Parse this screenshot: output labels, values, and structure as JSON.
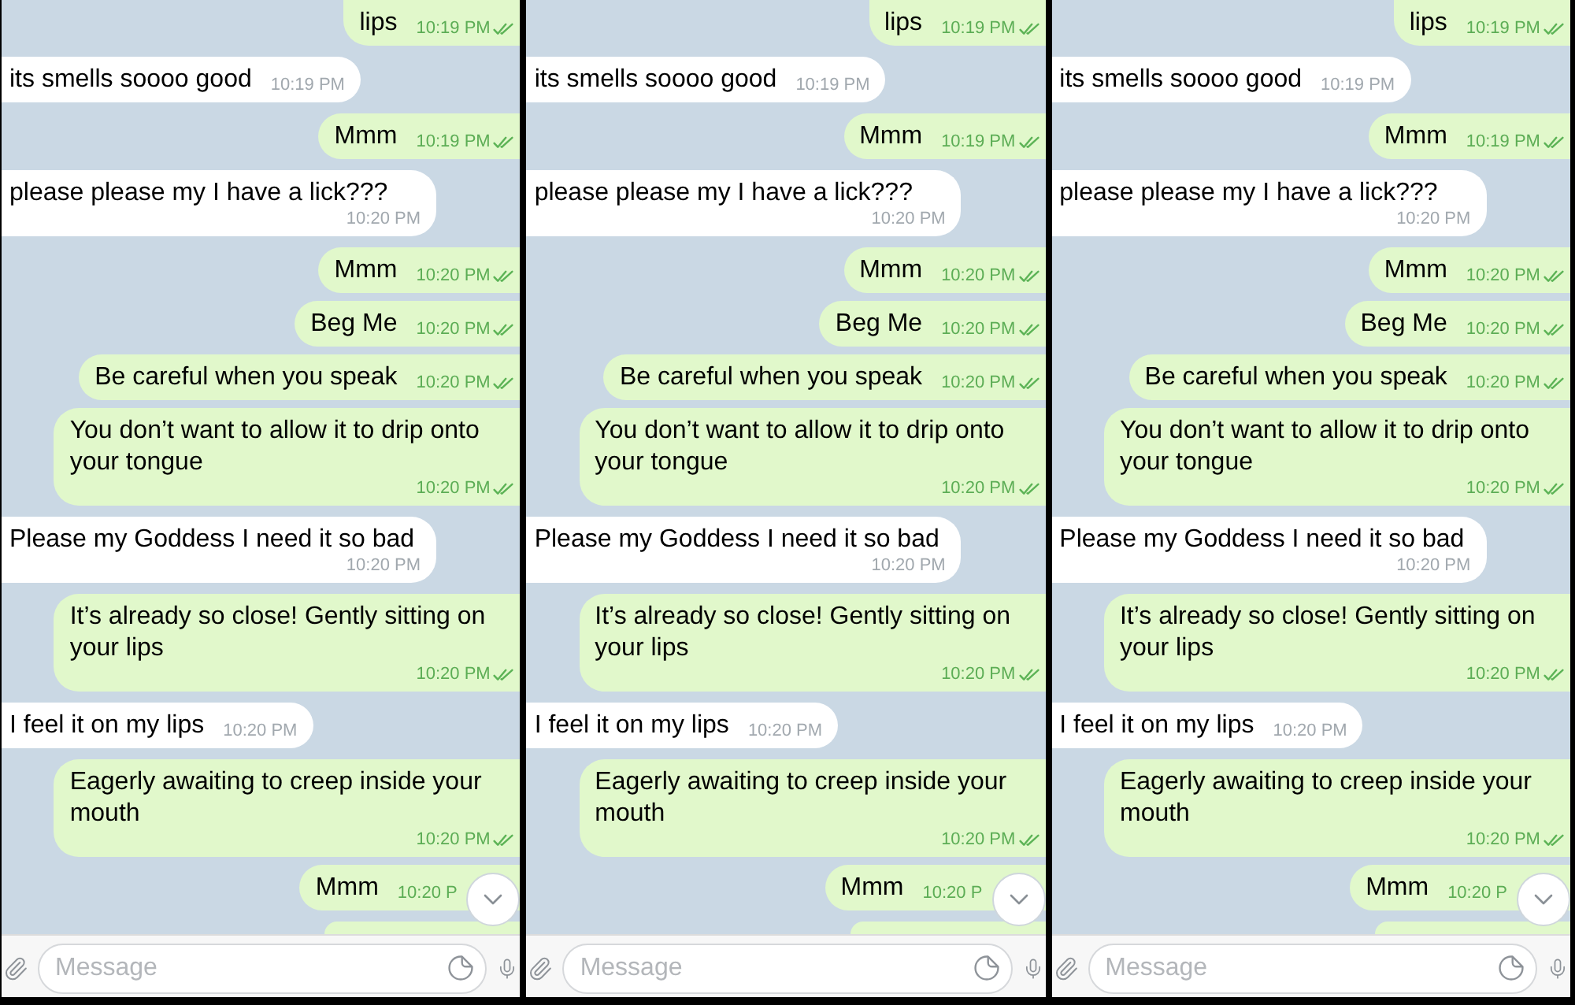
{
  "panels": [
    {
      "messages": [
        {
          "kind": "outgoing",
          "text": "lips",
          "time": "10:19 PM",
          "read": true
        },
        {
          "kind": "incoming",
          "text": "its smells soooo good",
          "time": "10:19 PM"
        },
        {
          "kind": "outgoing",
          "text": "Mmm",
          "time": "10:19 PM",
          "read": true
        },
        {
          "kind": "incoming",
          "text": "please please my I have a lick???",
          "time": "10:20 PM"
        },
        {
          "kind": "outgoing",
          "text": "Mmm",
          "time": "10:20 PM",
          "read": true
        },
        {
          "kind": "outgoing",
          "text": "Beg Me",
          "time": "10:20 PM",
          "read": true
        },
        {
          "kind": "outgoing",
          "text": "Be careful when you speak",
          "time": "10:20 PM",
          "read": true
        },
        {
          "kind": "outgoing",
          "text": "You don’t want to allow it to drip onto your tongue",
          "time": "10:20 PM",
          "read": true
        },
        {
          "kind": "incoming",
          "text": "Please my Goddess I need it so bad",
          "time": "10:20 PM"
        },
        {
          "kind": "outgoing",
          "text": "It’s already so close! Gently sitting on your lips",
          "time": "10:20 PM",
          "read": true
        },
        {
          "kind": "incoming",
          "text": "I feel it on my lips",
          "time": "10:20 PM"
        },
        {
          "kind": "outgoing",
          "text": "Eagerly awaiting to creep inside your mouth",
          "time": "10:20 PM",
          "read": true
        },
        {
          "kind": "outgoing",
          "text": "Mmm",
          "time": "10:20 P"
        },
        {
          "kind": "partial"
        }
      ],
      "composer": {
        "placeholder": "Message"
      }
    },
    {
      "messages": [
        {
          "kind": "outgoing",
          "text": "lips",
          "time": "10:19 PM",
          "read": true
        },
        {
          "kind": "incoming",
          "text": "its smells soooo good",
          "time": "10:19 PM"
        },
        {
          "kind": "outgoing",
          "text": "Mmm",
          "time": "10:19 PM",
          "read": true
        },
        {
          "kind": "incoming",
          "text": "please please my I have a lick???",
          "time": "10:20 PM"
        },
        {
          "kind": "outgoing",
          "text": "Mmm",
          "time": "10:20 PM",
          "read": true
        },
        {
          "kind": "outgoing",
          "text": "Beg Me",
          "time": "10:20 PM",
          "read": true
        },
        {
          "kind": "outgoing",
          "text": "Be careful when you speak",
          "time": "10:20 PM",
          "read": true
        },
        {
          "kind": "outgoing",
          "text": "You don’t want to allow it to drip onto your tongue",
          "time": "10:20 PM",
          "read": true
        },
        {
          "kind": "incoming",
          "text": "Please my Goddess I need it so bad",
          "time": "10:20 PM"
        },
        {
          "kind": "outgoing",
          "text": "It’s already so close! Gently sitting on your lips",
          "time": "10:20 PM",
          "read": true
        },
        {
          "kind": "incoming",
          "text": "I feel it on my lips",
          "time": "10:20 PM"
        },
        {
          "kind": "outgoing",
          "text": "Eagerly awaiting to creep inside your mouth",
          "time": "10:20 PM",
          "read": true
        },
        {
          "kind": "outgoing",
          "text": "Mmm",
          "time": "10:20 P"
        },
        {
          "kind": "partial"
        }
      ],
      "composer": {
        "placeholder": "Message"
      }
    },
    {
      "messages": [
        {
          "kind": "outgoing",
          "text": "lips",
          "time": "10:19 PM",
          "read": true
        },
        {
          "kind": "incoming",
          "text": "its smells soooo good",
          "time": "10:19 PM"
        },
        {
          "kind": "outgoing",
          "text": "Mmm",
          "time": "10:19 PM",
          "read": true
        },
        {
          "kind": "incoming",
          "text": "please please my I have a lick???",
          "time": "10:20 PM"
        },
        {
          "kind": "outgoing",
          "text": "Mmm",
          "time": "10:20 PM",
          "read": true
        },
        {
          "kind": "outgoing",
          "text": "Beg Me",
          "time": "10:20 PM",
          "read": true
        },
        {
          "kind": "outgoing",
          "text": "Be careful when you speak",
          "time": "10:20 PM",
          "read": true
        },
        {
          "kind": "outgoing",
          "text": "You don’t want to allow it to drip onto your tongue",
          "time": "10:20 PM",
          "read": true
        },
        {
          "kind": "incoming",
          "text": "Please my Goddess I need it so bad",
          "time": "10:20 PM"
        },
        {
          "kind": "outgoing",
          "text": "It’s already so close! Gently sitting on your lips",
          "time": "10:20 PM",
          "read": true
        },
        {
          "kind": "incoming",
          "text": "I feel it on my lips",
          "time": "10:20 PM"
        },
        {
          "kind": "outgoing",
          "text": "Eagerly awaiting to creep inside your mouth",
          "time": "10:20 PM",
          "read": true
        },
        {
          "kind": "outgoing",
          "text": "Mmm",
          "time": "10:20 P"
        },
        {
          "kind": "partial"
        }
      ],
      "composer": {
        "placeholder": "Message"
      }
    }
  ]
}
